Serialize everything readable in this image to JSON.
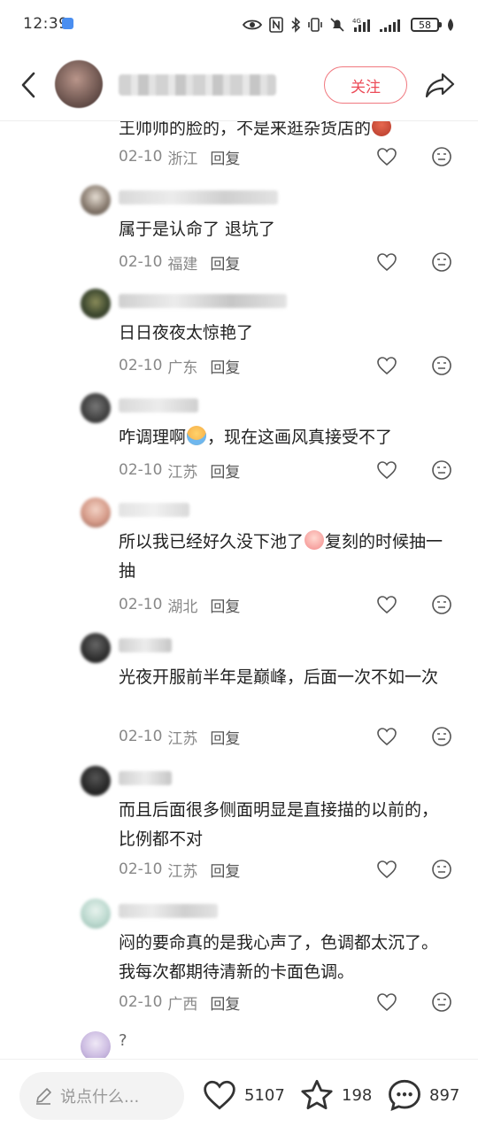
{
  "status_bar": {
    "time": "12:39",
    "battery": "58"
  },
  "header": {
    "follow_label": "关注"
  },
  "comments": [
    {
      "text": "王帅帅的脸的，不是来逛杂货店的",
      "date": "02-10",
      "location": "浙江",
      "reply_label": "回复"
    },
    {
      "text": "属于是认命了 退坑了",
      "date": "02-10",
      "location": "福建",
      "reply_label": "回复"
    },
    {
      "text": "日日夜夜太惊艳了",
      "date": "02-10",
      "location": "广东",
      "reply_label": "回复"
    },
    {
      "text_before": "咋调理啊",
      "text_after": "，现在这画风真接受不了",
      "date": "02-10",
      "location": "江苏",
      "reply_label": "回复"
    },
    {
      "text_before": "所以我已经好久没下池了",
      "text_after": "复刻的时候抽一抽",
      "date": "02-10",
      "location": "湖北",
      "reply_label": "回复"
    },
    {
      "text": "光夜开服前半年是巅峰，后面一次不如一次",
      "date": "02-10",
      "location": "江苏",
      "reply_label": "回复"
    },
    {
      "text": "而且后面很多侧面明显是直接描的以前的，比例都不对",
      "date": "02-10",
      "location": "江苏",
      "reply_label": "回复"
    },
    {
      "text": "闷的要命真的是我心声了，色调都太沉了。我每次都期待清新的卡面色调。",
      "date": "02-10",
      "location": "广西",
      "reply_label": "回复"
    },
    {
      "text": "?"
    }
  ],
  "bottom_bar": {
    "input_placeholder": "说点什么...",
    "likes": "5107",
    "stars": "198",
    "comments": "897"
  },
  "colors": {
    "accent": "#ec4b58",
    "meta_text": "#888888"
  }
}
